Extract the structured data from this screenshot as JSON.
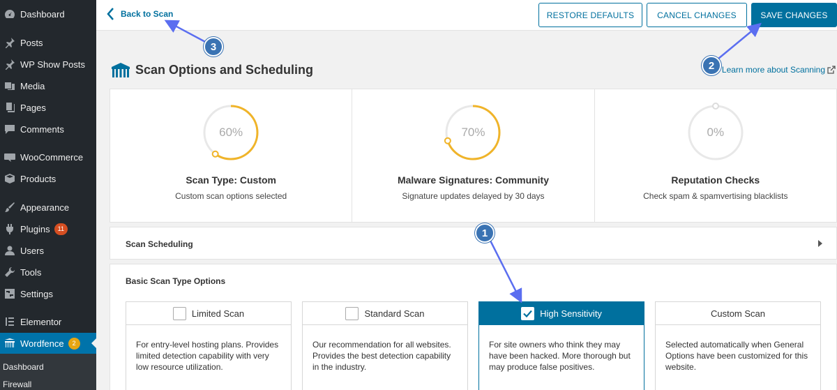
{
  "sidebar": {
    "items": [
      {
        "label": "Dashboard",
        "icon": "dashboard-icon"
      },
      {
        "label": "Posts",
        "icon": "pin-icon"
      },
      {
        "label": "WP Show Posts",
        "icon": "pin-icon"
      },
      {
        "label": "Media",
        "icon": "media-icon"
      },
      {
        "label": "Pages",
        "icon": "pages-icon"
      },
      {
        "label": "Comments",
        "icon": "comment-icon"
      },
      {
        "label": "WooCommerce",
        "icon": "woo-icon"
      },
      {
        "label": "Products",
        "icon": "box-icon"
      },
      {
        "label": "Appearance",
        "icon": "brush-icon"
      },
      {
        "label": "Plugins",
        "icon": "plug-icon",
        "badge": "11"
      },
      {
        "label": "Users",
        "icon": "user-icon"
      },
      {
        "label": "Tools",
        "icon": "wrench-icon"
      },
      {
        "label": "Settings",
        "icon": "settings-icon"
      },
      {
        "label": "Elementor",
        "icon": "elementor-icon"
      },
      {
        "label": "Wordfence",
        "icon": "wordfence-icon",
        "badge": "2"
      }
    ],
    "submenu": [
      "Dashboard",
      "Firewall"
    ]
  },
  "topbar": {
    "back_label": "Back to Scan",
    "restore_label": "RESTORE DEFAULTS",
    "cancel_label": "CANCEL CHANGES",
    "save_label": "SAVE CHANGES"
  },
  "page": {
    "title": "Scan Options and Scheduling",
    "learn_more": "Learn more about Scanning"
  },
  "stats": [
    {
      "percent": "60%",
      "value": 0.6,
      "title": "Scan Type: Custom",
      "desc": "Custom scan options selected"
    },
    {
      "percent": "70%",
      "value": 0.7,
      "title": "Malware Signatures: Community",
      "desc": "Signature updates delayed by 30 days"
    },
    {
      "percent": "0%",
      "value": 0.0,
      "title": "Reputation Checks",
      "desc": "Check spam & spamvertising blacklists"
    }
  ],
  "scheduling": {
    "title": "Scan Scheduling"
  },
  "basic": {
    "title": "Basic Scan Type Options",
    "options": [
      {
        "label": "Limited Scan",
        "desc": "For entry-level hosting plans. Provides limited detection capability with very low resource utilization.",
        "checkbox": true,
        "selected": false
      },
      {
        "label": "Standard Scan",
        "desc": "Our recommendation for all websites. Provides the best detection capability in the industry.",
        "checkbox": true,
        "selected": false
      },
      {
        "label": "High Sensitivity",
        "desc": "For site owners who think they may have been hacked. More thorough but may produce false positives.",
        "checkbox": true,
        "selected": true
      },
      {
        "label": "Custom Scan",
        "desc": "Selected automatically when General Options have been customized for this website.",
        "checkbox": false,
        "selected": false
      }
    ]
  },
  "annotations": [
    "1",
    "2",
    "3"
  ],
  "colors": {
    "accent": "#00709e",
    "gauge": "#f0b429",
    "annotation": "#3a73b3",
    "sidebar": "#23282d"
  }
}
